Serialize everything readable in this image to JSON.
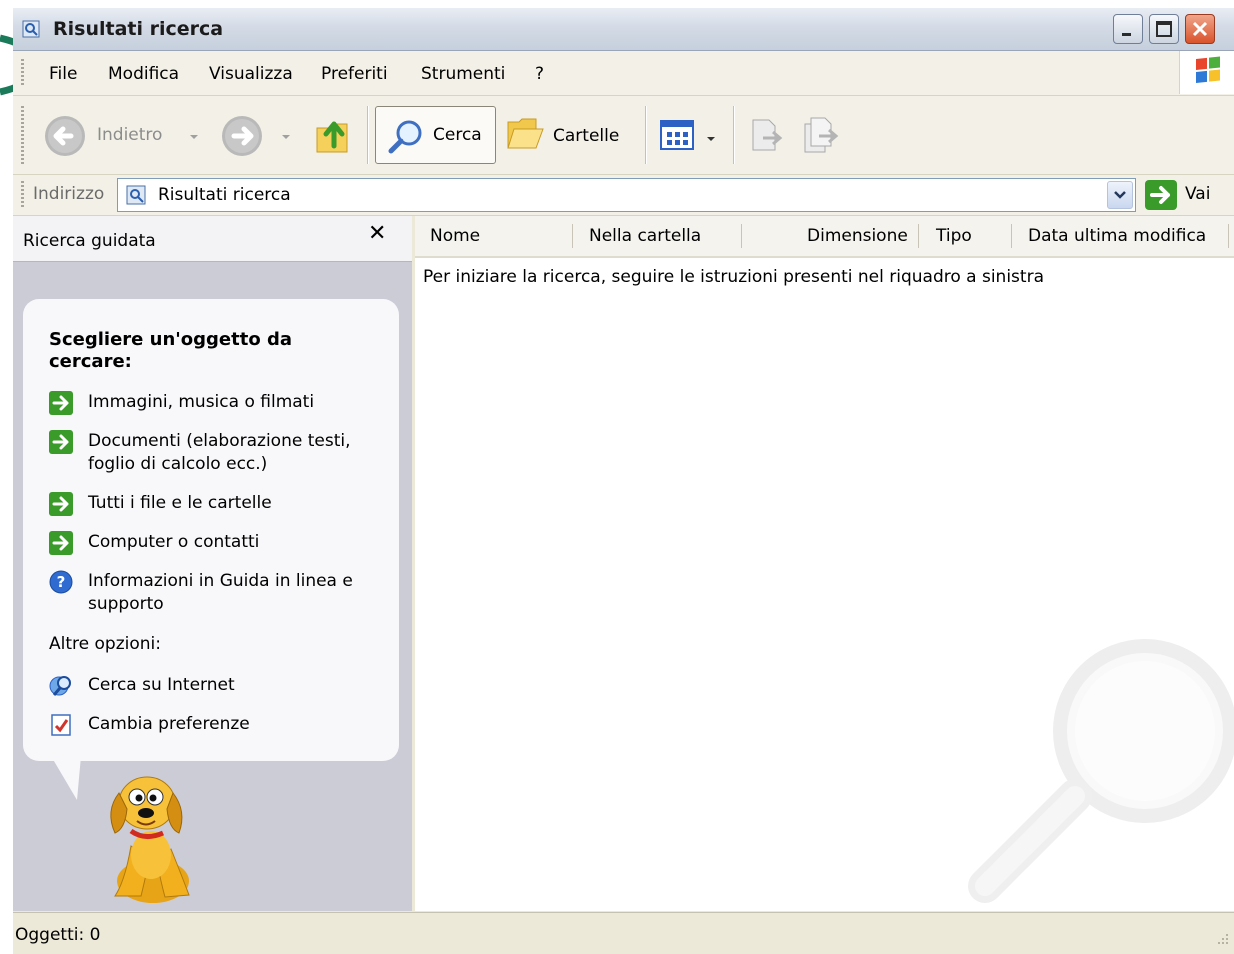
{
  "window": {
    "title": "Risultati ricerca"
  },
  "menu": {
    "items": [
      "File",
      "Modifica",
      "Visualizza",
      "Preferiti",
      "Strumenti",
      "?"
    ]
  },
  "toolbar": {
    "back_label": "Indietro",
    "search_label": "Cerca",
    "folders_label": "Cartelle"
  },
  "address": {
    "label": "Indirizzo",
    "value": "Risultati ricerca",
    "go_label": "Vai"
  },
  "search_pane": {
    "title": "Ricerca guidata",
    "heading": "Scegliere un'oggetto da cercare:",
    "options": [
      {
        "label": "Immagini, musica o filmati",
        "icon": "green-arrow-icon"
      },
      {
        "label": "Documenti (elaborazione testi, foglio di calcolo ecc.)",
        "icon": "green-arrow-icon"
      },
      {
        "label": "Tutti i file e le cartelle",
        "icon": "green-arrow-icon"
      },
      {
        "label": "Computer o contatti",
        "icon": "green-arrow-icon"
      },
      {
        "label": "Informazioni in Guida in linea e supporto",
        "icon": "help-icon"
      }
    ],
    "other_heading": "Altre opzioni:",
    "other_options": [
      {
        "label": "Cerca su Internet",
        "icon": "internet-search-icon"
      },
      {
        "label": "Cambia preferenze",
        "icon": "preferences-icon"
      }
    ]
  },
  "results": {
    "columns": [
      "Nome",
      "Nella cartella",
      "Dimensione",
      "Tipo",
      "Data ultima modifica"
    ],
    "empty_message": "Per iniziare la ricerca, seguire le istruzioni presenti nel riquadro a sinistra"
  },
  "status": {
    "text": "Oggetti: 0"
  },
  "colors": {
    "accent_green": "#3a9a2a",
    "pane_bg": "#ccccd6",
    "toolbar_bg": "#f3f1e7"
  }
}
